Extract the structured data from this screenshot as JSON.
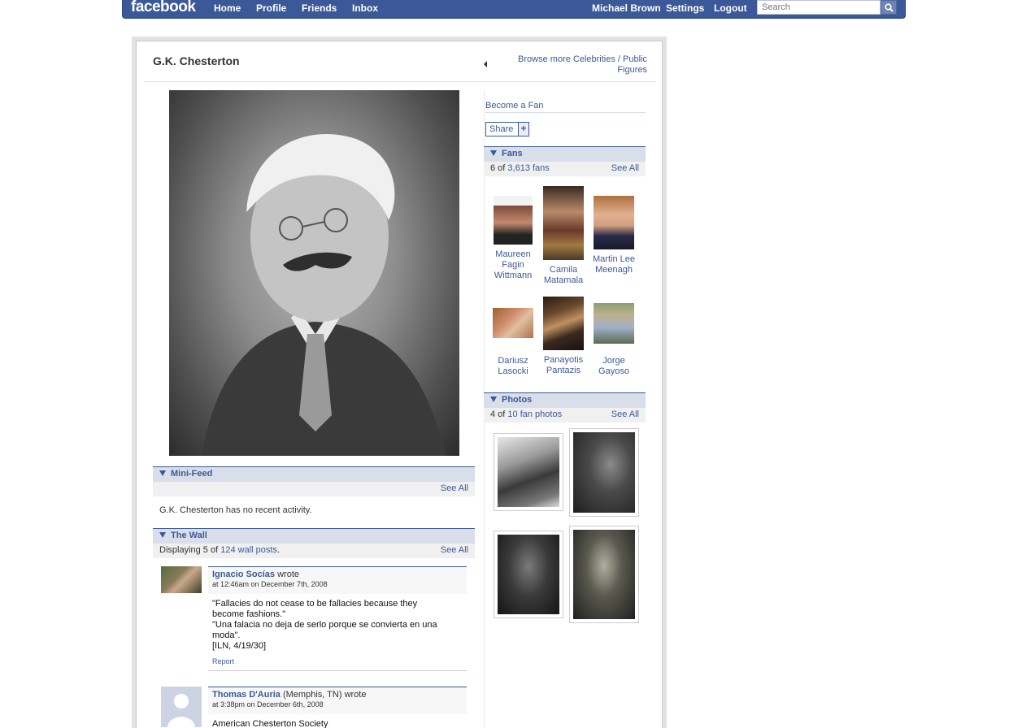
{
  "topbar": {
    "logo": "facebook",
    "nav": [
      "Home",
      "Profile",
      "Friends",
      "Inbox"
    ],
    "user": "Michael Brown",
    "settings": "Settings",
    "logout": "Logout",
    "search_placeholder": "Search"
  },
  "page": {
    "title": "G.K. Chesterton",
    "browse_link": "Browse more Celebrities / Public Figures"
  },
  "minifeed": {
    "heading": "Mini-Feed",
    "see_all": "See All",
    "empty_text": "G.K. Chesterton has no recent activity."
  },
  "wall": {
    "heading": "The Wall",
    "summary_prefix": "Displaying 5 of",
    "summary_link": "124 wall posts",
    "summary_suffix": ".",
    "see_all": "See All",
    "posts": [
      {
        "author": "Ignacio Socías",
        "author_extra": "",
        "wrote": "wrote",
        "time": "at 12:46am on December 7th, 2008",
        "lines": [
          "\"Fallacies do not cease to be fallacies because they",
          "become fashions.\"",
          "\"Una falacia no deja de serlo porque se convierta en una",
          "moda\".",
          "[ILN, 4/19/30]"
        ],
        "report": "Report"
      },
      {
        "author": "Thomas D'Auria",
        "author_extra": "(Memphis, TN)",
        "wrote": "wrote",
        "time": "at 3:38pm on December 6th, 2008",
        "lines": [
          "American Chesterton Society"
        ],
        "report": ""
      }
    ]
  },
  "sidebar": {
    "become_fan": "Become a Fan",
    "share": "Share",
    "share_plus": "+",
    "fans": {
      "heading": "Fans",
      "count_prefix": "6 of",
      "count_link": "3,613 fans",
      "see_all": "See All",
      "people": [
        {
          "name_lines": [
            "Maureen",
            "Fagin",
            "Wittmann"
          ]
        },
        {
          "name_lines": [
            "Camila",
            "Matamala"
          ]
        },
        {
          "name_lines": [
            "Martin Lee",
            "Meenagh"
          ]
        },
        {
          "name_lines": [
            "Dariusz",
            "Lasocki"
          ]
        },
        {
          "name_lines": [
            "Panayotis",
            "Pantazis"
          ]
        },
        {
          "name_lines": [
            "Jorge",
            "Gayoso"
          ]
        }
      ]
    },
    "photos": {
      "heading": "Photos",
      "count_prefix": "4 of",
      "count_link": "10 fan photos",
      "see_all": "See All"
    }
  },
  "colors": {
    "brand": "#3b5998",
    "section_bg": "#d8dfea"
  }
}
